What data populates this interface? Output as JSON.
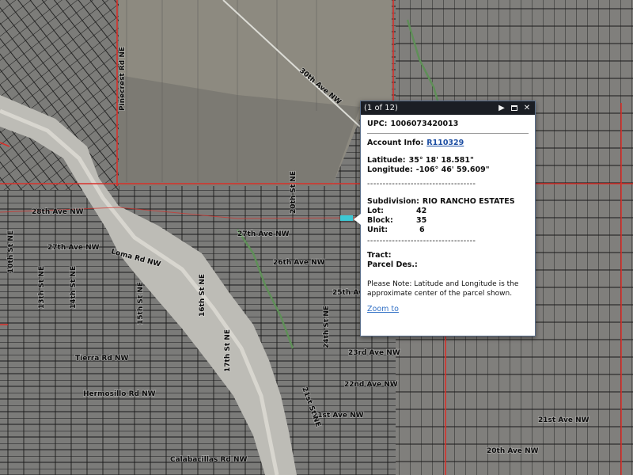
{
  "map": {
    "roads": {
      "pinecrest": "Pinecrest Rd NE",
      "ave_30th": "30th Ave NW",
      "ave_28th": "28th Ave NW",
      "ave_27th": "27th Ave NW",
      "ave_27th_b": "27th Ave NW",
      "ave_26th": "26th Ave NW",
      "ave_25th": "25th Ave NW",
      "ave_23rd": "23rd Ave NW",
      "ave_22nd": "22nd Ave NW",
      "ave_21st": "21st Ave NW",
      "ave_21st_b": "21st Ave NW",
      "ave_20th": "20th Ave NW",
      "hermosillo": "Hermosillo Rd NW",
      "calabacillas": "Calabacillas Rd NW",
      "tierra": "Tierra Rd NW",
      "loma": "Loma Rd NW",
      "st_10th": "10th St NE",
      "st_13th": "13th St NE",
      "st_14th": "14th St NE",
      "st_15th": "15th St NE",
      "st_16th": "16th St NE",
      "st_17th": "17th St NE",
      "st_20th": "20th St NE",
      "st_21st": "21st St NE",
      "st_24th": "24th St NE"
    }
  },
  "popup": {
    "count": "(1 of 12)",
    "upc_label": "UPC:",
    "upc_value": "1006073420013",
    "account_label": "Account Info:",
    "account_value": "R110329",
    "latitude_label": "Latitude:",
    "latitude_value": "35° 18' 18.581\"",
    "longitude_label": "Longitude:",
    "longitude_value": "-106° 46' 59.609\"",
    "divider": "-----------------------------------",
    "subdivision_label": "Subdivision:",
    "subdivision_value": "RIO RANCHO ESTATES",
    "lot_label": "Lot:",
    "lot_value": "42",
    "block_label": "Block:",
    "block_value": "35",
    "unit_label": "Unit:",
    "unit_value": "6",
    "tract_label": "Tract:",
    "parcel_label": "Parcel Des.:",
    "note": "Please Note: Latitude and Longitude is the approximate center of the parcel shown.",
    "zoom_label": "Zoom to"
  },
  "colors": {
    "boundary": "#d8312b",
    "selected_parcel": "#3cc9d4",
    "popup_header": "#1b1e24",
    "link": "#1e4fa3"
  }
}
